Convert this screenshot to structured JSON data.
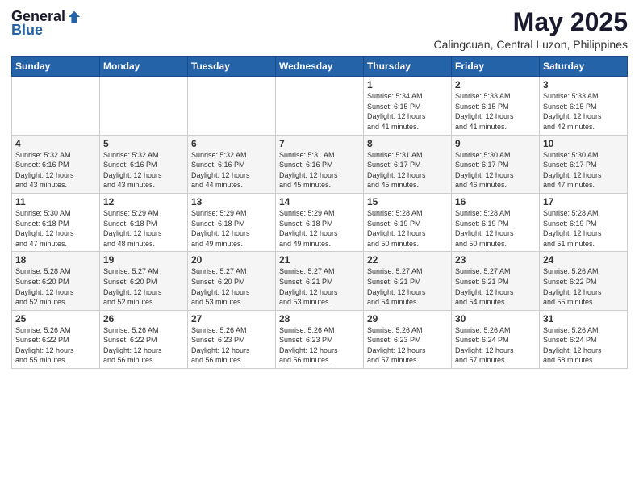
{
  "header": {
    "logo_general": "General",
    "logo_blue": "Blue",
    "month_title": "May 2025",
    "location": "Calingcuan, Central Luzon, Philippines"
  },
  "weekdays": [
    "Sunday",
    "Monday",
    "Tuesday",
    "Wednesday",
    "Thursday",
    "Friday",
    "Saturday"
  ],
  "rows": [
    [
      {
        "day": "",
        "info": ""
      },
      {
        "day": "",
        "info": ""
      },
      {
        "day": "",
        "info": ""
      },
      {
        "day": "",
        "info": ""
      },
      {
        "day": "1",
        "info": "Sunrise: 5:34 AM\nSunset: 6:15 PM\nDaylight: 12 hours\nand 41 minutes."
      },
      {
        "day": "2",
        "info": "Sunrise: 5:33 AM\nSunset: 6:15 PM\nDaylight: 12 hours\nand 41 minutes."
      },
      {
        "day": "3",
        "info": "Sunrise: 5:33 AM\nSunset: 6:15 PM\nDaylight: 12 hours\nand 42 minutes."
      }
    ],
    [
      {
        "day": "4",
        "info": "Sunrise: 5:32 AM\nSunset: 6:16 PM\nDaylight: 12 hours\nand 43 minutes."
      },
      {
        "day": "5",
        "info": "Sunrise: 5:32 AM\nSunset: 6:16 PM\nDaylight: 12 hours\nand 43 minutes."
      },
      {
        "day": "6",
        "info": "Sunrise: 5:32 AM\nSunset: 6:16 PM\nDaylight: 12 hours\nand 44 minutes."
      },
      {
        "day": "7",
        "info": "Sunrise: 5:31 AM\nSunset: 6:16 PM\nDaylight: 12 hours\nand 45 minutes."
      },
      {
        "day": "8",
        "info": "Sunrise: 5:31 AM\nSunset: 6:17 PM\nDaylight: 12 hours\nand 45 minutes."
      },
      {
        "day": "9",
        "info": "Sunrise: 5:30 AM\nSunset: 6:17 PM\nDaylight: 12 hours\nand 46 minutes."
      },
      {
        "day": "10",
        "info": "Sunrise: 5:30 AM\nSunset: 6:17 PM\nDaylight: 12 hours\nand 47 minutes."
      }
    ],
    [
      {
        "day": "11",
        "info": "Sunrise: 5:30 AM\nSunset: 6:18 PM\nDaylight: 12 hours\nand 47 minutes."
      },
      {
        "day": "12",
        "info": "Sunrise: 5:29 AM\nSunset: 6:18 PM\nDaylight: 12 hours\nand 48 minutes."
      },
      {
        "day": "13",
        "info": "Sunrise: 5:29 AM\nSunset: 6:18 PM\nDaylight: 12 hours\nand 49 minutes."
      },
      {
        "day": "14",
        "info": "Sunrise: 5:29 AM\nSunset: 6:18 PM\nDaylight: 12 hours\nand 49 minutes."
      },
      {
        "day": "15",
        "info": "Sunrise: 5:28 AM\nSunset: 6:19 PM\nDaylight: 12 hours\nand 50 minutes."
      },
      {
        "day": "16",
        "info": "Sunrise: 5:28 AM\nSunset: 6:19 PM\nDaylight: 12 hours\nand 50 minutes."
      },
      {
        "day": "17",
        "info": "Sunrise: 5:28 AM\nSunset: 6:19 PM\nDaylight: 12 hours\nand 51 minutes."
      }
    ],
    [
      {
        "day": "18",
        "info": "Sunrise: 5:28 AM\nSunset: 6:20 PM\nDaylight: 12 hours\nand 52 minutes."
      },
      {
        "day": "19",
        "info": "Sunrise: 5:27 AM\nSunset: 6:20 PM\nDaylight: 12 hours\nand 52 minutes."
      },
      {
        "day": "20",
        "info": "Sunrise: 5:27 AM\nSunset: 6:20 PM\nDaylight: 12 hours\nand 53 minutes."
      },
      {
        "day": "21",
        "info": "Sunrise: 5:27 AM\nSunset: 6:21 PM\nDaylight: 12 hours\nand 53 minutes."
      },
      {
        "day": "22",
        "info": "Sunrise: 5:27 AM\nSunset: 6:21 PM\nDaylight: 12 hours\nand 54 minutes."
      },
      {
        "day": "23",
        "info": "Sunrise: 5:27 AM\nSunset: 6:21 PM\nDaylight: 12 hours\nand 54 minutes."
      },
      {
        "day": "24",
        "info": "Sunrise: 5:26 AM\nSunset: 6:22 PM\nDaylight: 12 hours\nand 55 minutes."
      }
    ],
    [
      {
        "day": "25",
        "info": "Sunrise: 5:26 AM\nSunset: 6:22 PM\nDaylight: 12 hours\nand 55 minutes."
      },
      {
        "day": "26",
        "info": "Sunrise: 5:26 AM\nSunset: 6:22 PM\nDaylight: 12 hours\nand 56 minutes."
      },
      {
        "day": "27",
        "info": "Sunrise: 5:26 AM\nSunset: 6:23 PM\nDaylight: 12 hours\nand 56 minutes."
      },
      {
        "day": "28",
        "info": "Sunrise: 5:26 AM\nSunset: 6:23 PM\nDaylight: 12 hours\nand 56 minutes."
      },
      {
        "day": "29",
        "info": "Sunrise: 5:26 AM\nSunset: 6:23 PM\nDaylight: 12 hours\nand 57 minutes."
      },
      {
        "day": "30",
        "info": "Sunrise: 5:26 AM\nSunset: 6:24 PM\nDaylight: 12 hours\nand 57 minutes."
      },
      {
        "day": "31",
        "info": "Sunrise: 5:26 AM\nSunset: 6:24 PM\nDaylight: 12 hours\nand 58 minutes."
      }
    ]
  ]
}
